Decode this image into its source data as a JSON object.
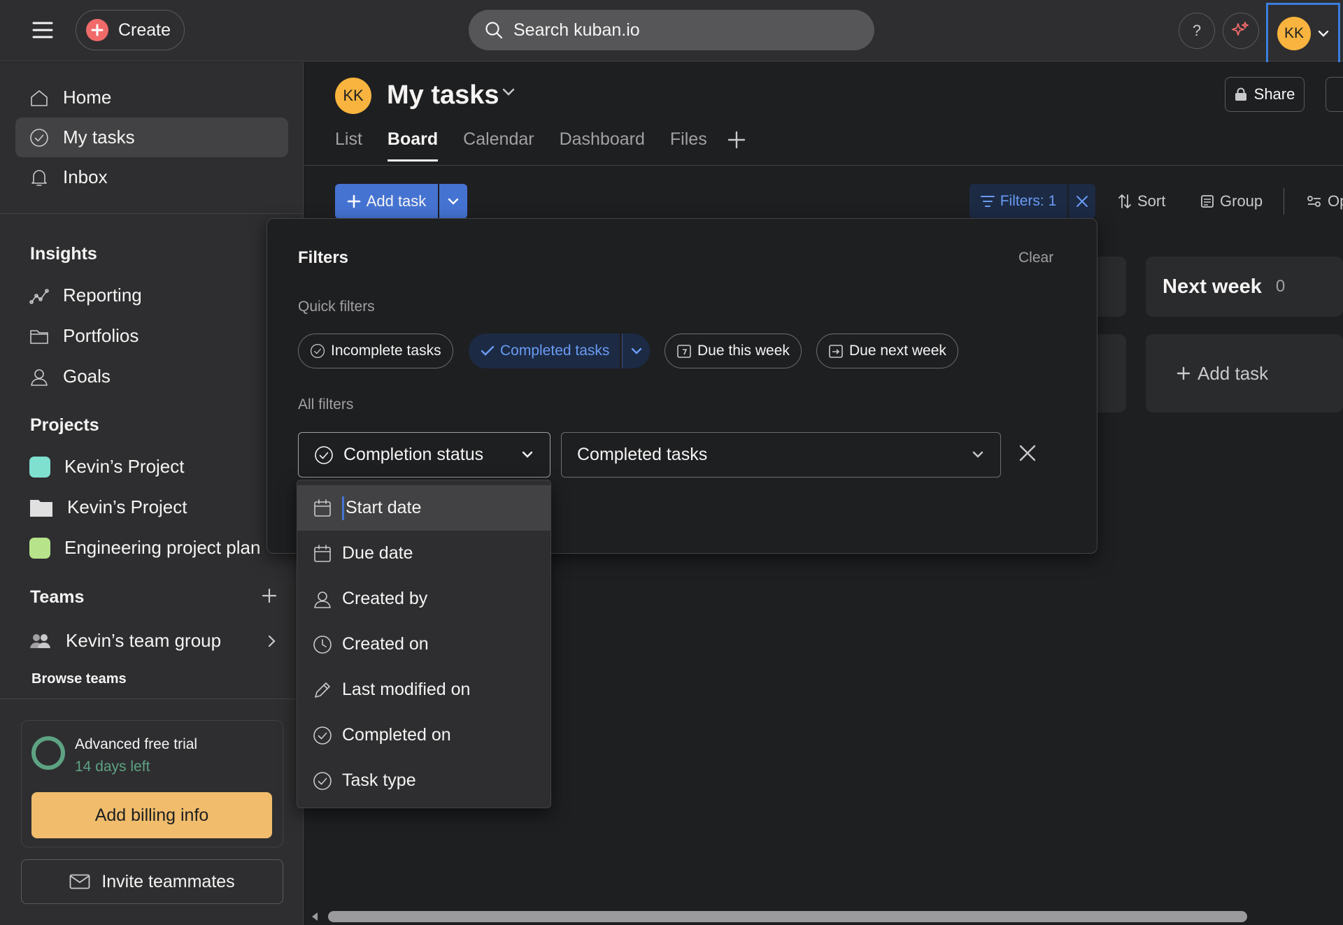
{
  "topbar": {
    "create_label": "Create",
    "search_placeholder": "Search kuban.io",
    "help_label": "?",
    "user_initials": "KK"
  },
  "sidebar": {
    "nav": [
      {
        "label": "Home",
        "icon": "home-icon"
      },
      {
        "label": "My tasks",
        "icon": "check-circle-icon",
        "active": true
      },
      {
        "label": "Inbox",
        "icon": "bell-icon"
      }
    ],
    "insights": {
      "heading": "Insights",
      "items": [
        {
          "label": "Reporting",
          "icon": "chart-line-icon"
        },
        {
          "label": "Portfolios",
          "icon": "folder-icon"
        },
        {
          "label": "Goals",
          "icon": "person-icon"
        }
      ]
    },
    "projects": {
      "heading": "Projects",
      "items": [
        {
          "label": "Kevin’s Project",
          "color": "#7fe0d0"
        },
        {
          "label": "Kevin’s Project",
          "color": "#e0e0e0"
        },
        {
          "label": "Engineering project plan",
          "color": "#b7e38a"
        }
      ]
    },
    "teams": {
      "heading": "Teams",
      "items": [
        {
          "label": "Kevin’s team group",
          "icon": "team-icon"
        }
      ],
      "browse": "Browse teams"
    },
    "trial": {
      "title": "Advanced free trial",
      "days_left": "14 days left",
      "billing_button": "Add billing info"
    },
    "invite": "Invite teammates"
  },
  "main": {
    "avatar_initials": "KK",
    "title": "My tasks",
    "share_label": "Share",
    "tabs": [
      {
        "label": "List"
      },
      {
        "label": "Board",
        "active": true
      },
      {
        "label": "Calendar"
      },
      {
        "label": "Dashboard"
      },
      {
        "label": "Files"
      }
    ],
    "toolbar": {
      "add_task": "Add task",
      "filters": "Filters: 1",
      "sort": "Sort",
      "group": "Group",
      "options": "Op"
    },
    "board": {
      "next_week_title": "Next week",
      "next_week_count": "0",
      "add_task": "Add task"
    }
  },
  "filters_panel": {
    "title": "Filters",
    "clear": "Clear",
    "quick_filters_label": "Quick filters",
    "quick_filters": [
      {
        "label": "Incomplete tasks",
        "icon": "check-circle-icon"
      },
      {
        "label": "Completed tasks",
        "icon": "check-icon",
        "selected": true
      },
      {
        "label": "Due this week",
        "icon": "calendar-7-icon"
      },
      {
        "label": "Due next week",
        "icon": "calendar-arrow-icon"
      }
    ],
    "all_filters_label": "All filters",
    "field_select": "Completion status",
    "value_select": "Completed tasks"
  },
  "field_dropdown": {
    "options": [
      {
        "label": "Start date",
        "icon": "calendar-icon",
        "highlighted": true
      },
      {
        "label": "Due date",
        "icon": "calendar-icon"
      },
      {
        "label": "Created by",
        "icon": "person-icon"
      },
      {
        "label": "Created on",
        "icon": "clock-icon"
      },
      {
        "label": "Last modified on",
        "icon": "pencil-icon"
      },
      {
        "label": "Completed on",
        "icon": "check-circle-icon"
      },
      {
        "label": "Task type",
        "icon": "check-circle-icon"
      }
    ]
  },
  "colors": {
    "accent": "#4573d2",
    "avatar": "#f8b43e",
    "billing": "#f1bd6c",
    "trial_ring": "#5da283",
    "create_plus": "#f06a6a"
  }
}
